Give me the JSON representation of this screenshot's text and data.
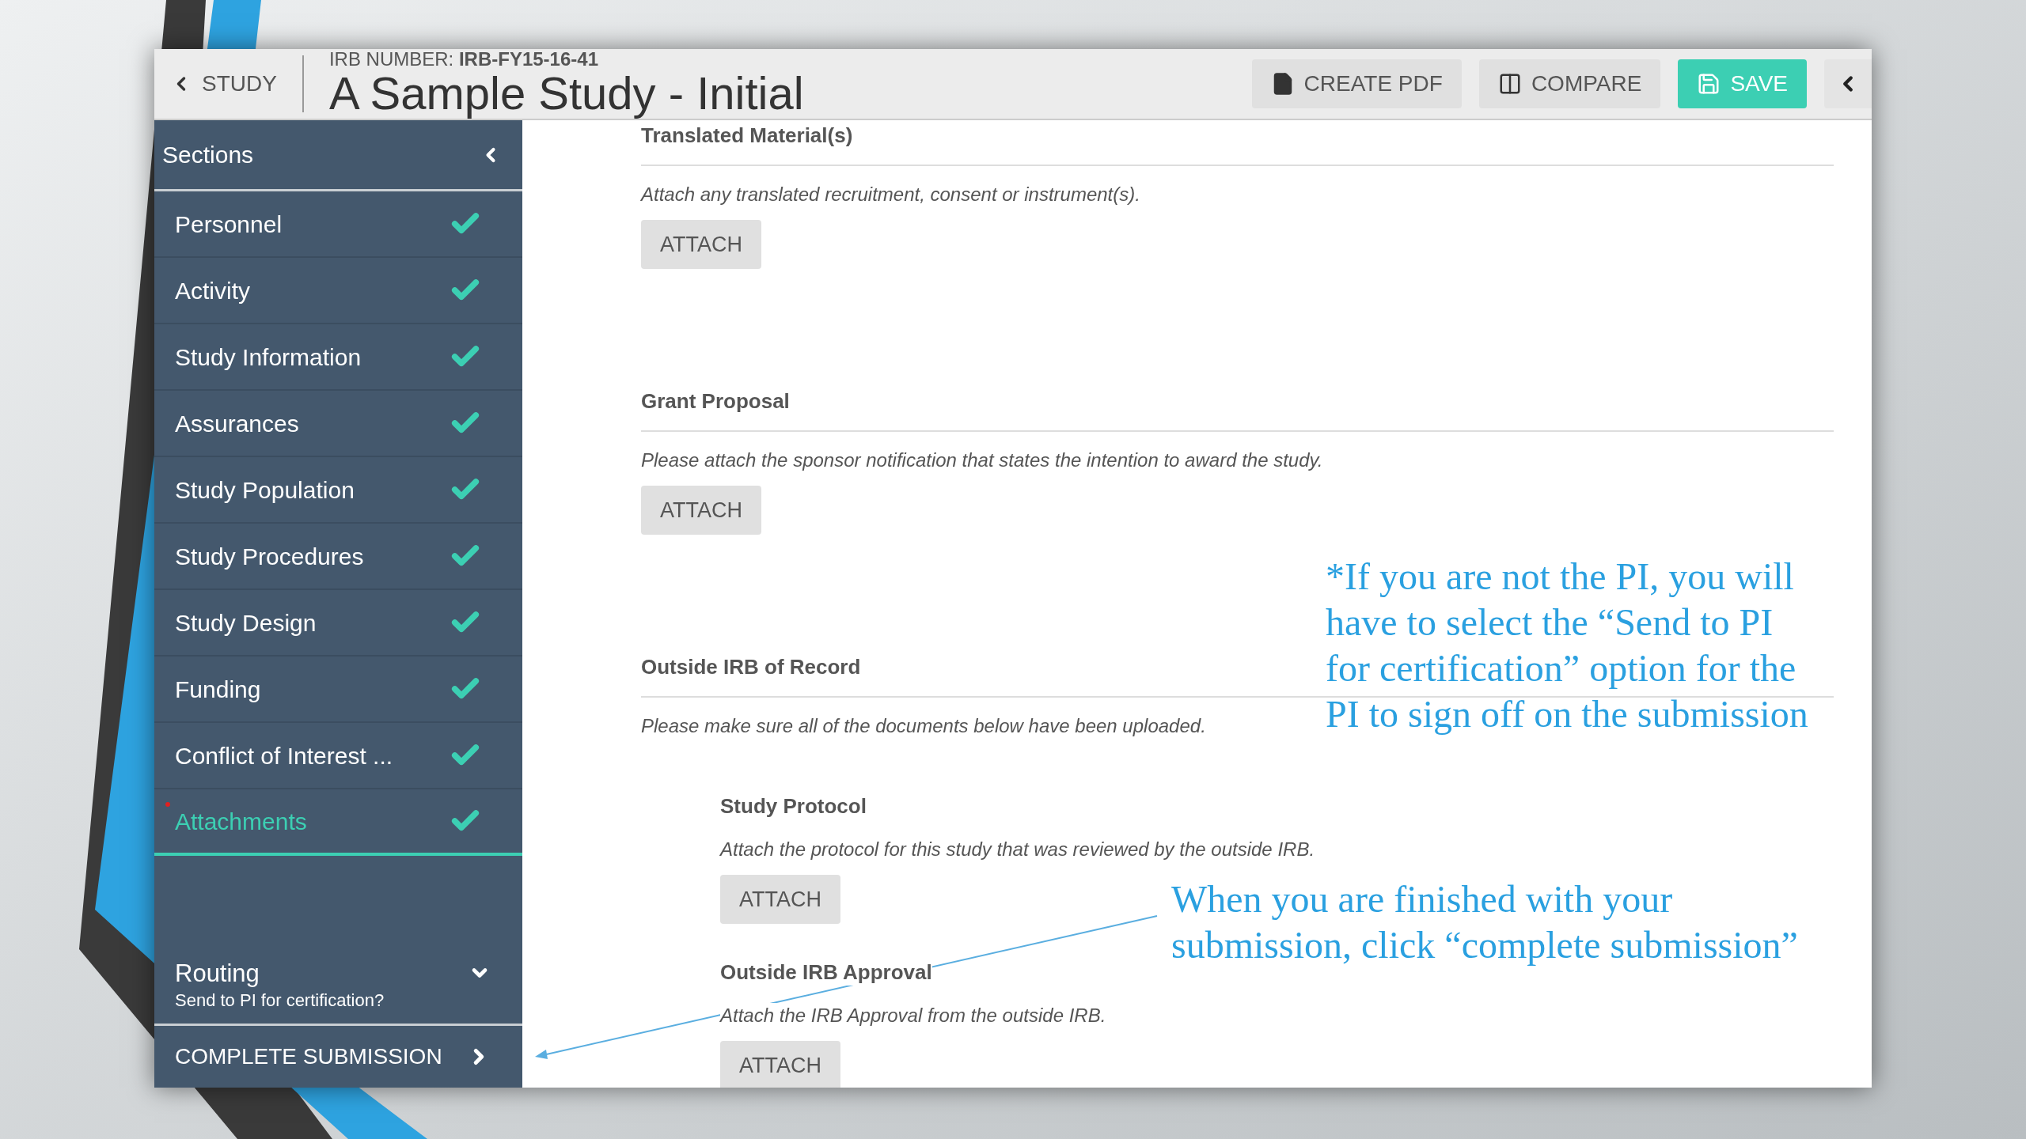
{
  "header": {
    "back_button": "STUDY",
    "irb_number": "IRB NUMBER: **IRB-FY15-16-41**",
    "title": "A Sample Study - Initial",
    "actions": [
      {
        "label": "CREATE PDF",
        "kind": "pdf"
      },
      {
        "label": "COMPARE",
        "kind": "compare"
      },
      {
        "label": "SAVE",
        "kind": "save"
      }
    ]
  },
  "sidebar": {
    "title": "Sections",
    "items": [
      {
        "label": "Personnel",
        "complete": true,
        "selected": false,
        "flagged": false
      },
      {
        "label": "Activity",
        "complete": true,
        "selected": false,
        "flagged": false
      },
      {
        "label": "Study Information",
        "complete": true,
        "selected": false,
        "flagged": false
      },
      {
        "label": "Assurances",
        "complete": true,
        "selected": false,
        "flagged": false
      },
      {
        "label": "Study Population",
        "complete": true,
        "selected": false,
        "flagged": false
      },
      {
        "label": "Study Procedures",
        "complete": true,
        "selected": false,
        "flagged": false
      },
      {
        "label": "Study Design",
        "complete": true,
        "selected": false,
        "flagged": false
      },
      {
        "label": "Funding",
        "complete": true,
        "selected": false,
        "flagged": false
      },
      {
        "label": "Conflict of Interest ...",
        "complete": true,
        "selected": false,
        "flagged": false
      },
      {
        "label": "Attachments",
        "complete": true,
        "selected": true,
        "flagged": true
      }
    ],
    "routing": {
      "title": "Routing",
      "subtitle": "Send to PI for certification?"
    },
    "complete_button": "COMPLETE SUBMISSION"
  },
  "content": {
    "sections": [
      {
        "title": "Translated Material(s)",
        "description": "Attach any translated recruitment, consent or instrument(s).",
        "button": "ATTACH"
      },
      {
        "title": "Grant Proposal",
        "description": "Please attach the sponsor notification that states the intention to award the study.",
        "button": "ATTACH"
      },
      {
        "title": "Outside IRB of Record",
        "description": "Please make sure all of the documents below have been uploaded.",
        "subsections": [
          {
            "title": "Study Protocol",
            "description": "Attach the protocol for this study that was reviewed by the outside IRB.",
            "button": "ATTACH"
          },
          {
            "title": "Outside IRB Approval",
            "description": "Attach the IRB Approval from the outside IRB.",
            "button": "ATTACH"
          }
        ]
      }
    ]
  },
  "annotations": [
    {
      "kind": "note",
      "text": "*If you are not the PI, you will have to select the “Send to PI for certification” option for the PI to sign off on the submission"
    },
    {
      "kind": "pointer",
      "text": "When you are finished with your submission, click “complete submission”"
    }
  ]
}
